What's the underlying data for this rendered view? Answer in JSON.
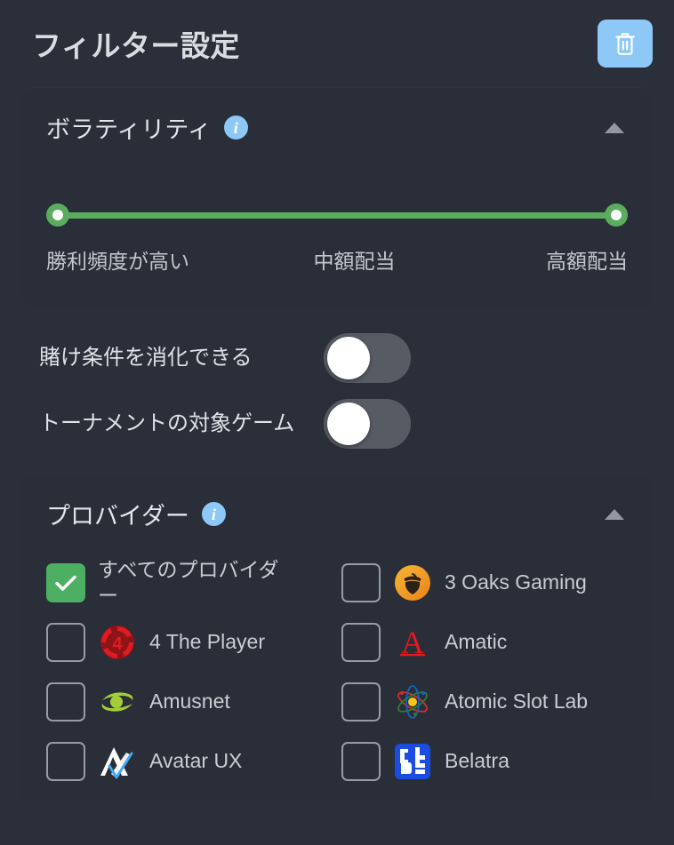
{
  "header": {
    "title": "フィルター設定",
    "clear_button_icon": "trash-icon"
  },
  "volatility": {
    "title": "ボラティリティ",
    "info_icon": "info-icon",
    "collapse_icon": "chevron-up-icon",
    "slider": {
      "left_handle_value": "0",
      "right_handle_value": "100",
      "track_color": "#5aac5e"
    },
    "labels": {
      "low": "勝利頻度が高い",
      "mid": "中額配当",
      "high": "高額配当"
    }
  },
  "toggles": [
    {
      "label": "賭け条件を消化できる",
      "state": "off"
    },
    {
      "label": "トーナメントの対象ゲーム",
      "state": "off"
    }
  ],
  "providers": {
    "title": "プロバイダー",
    "info_icon": "info-icon",
    "collapse_icon": "chevron-up-icon",
    "items": [
      {
        "name": "すべてのプロバイダー",
        "checked": true,
        "logo": "none"
      },
      {
        "name": "3 Oaks Gaming",
        "checked": false,
        "logo": "acorn-logo"
      },
      {
        "name": "4 The Player",
        "checked": false,
        "logo": "four-circle-logo"
      },
      {
        "name": "Amatic",
        "checked": false,
        "logo": "letter-a-logo"
      },
      {
        "name": "Amusnet",
        "checked": false,
        "logo": "eye-swoosh-logo"
      },
      {
        "name": "Atomic Slot Lab",
        "checked": false,
        "logo": "atom-logo"
      },
      {
        "name": "Avatar UX",
        "checked": false,
        "logo": "avatar-peak-logo"
      },
      {
        "name": "Belatra",
        "checked": false,
        "logo": "belatra-square-logo"
      }
    ]
  },
  "colors": {
    "page_background": "#2b2f3a",
    "card_background": "#2a2e38",
    "accent_blue": "#8ec8f6",
    "accent_green": "#4caf62",
    "slider_green": "#5aac5e",
    "text_primary": "#dfe2e7",
    "text_secondary": "#c8ccd3"
  }
}
